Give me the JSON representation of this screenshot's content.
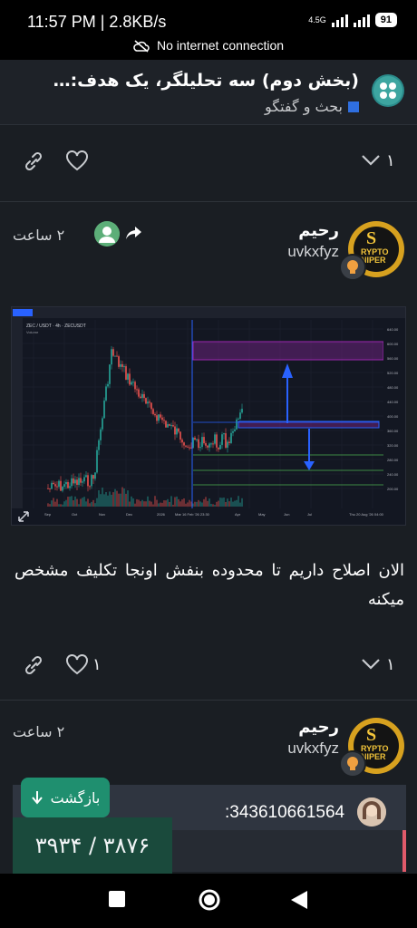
{
  "status_bar": {
    "time": "11:57 PM | 2.8KB/s",
    "network": "4.5G",
    "battery": "91",
    "offline_message": "No internet connection"
  },
  "topic": {
    "title": "(بخش دوم) سه تحلیلگر، یک هدف: سود گ...",
    "category": "بحث و گفتگو"
  },
  "prev_post_actions": {
    "like_count": "",
    "replies_count": "۱"
  },
  "post": {
    "author_name": "رحیم",
    "username": "uvkxfyz",
    "time": "۲ ساعت",
    "text": "الان اصلاح داریم تا محدوده بنفش اونجا تکلیف مشخص میکنه",
    "like_count": "۱",
    "replies_count": "۱"
  },
  "chart": {
    "symbol": "ZEC / USDT · 4h · ZECUSDT",
    "indicator": "Volume",
    "price_labels": [
      "640.00",
      "600.00",
      "560.00",
      "520.00",
      "480.00",
      "440.00",
      "400.00",
      "360.00",
      "320.00",
      "280.00",
      "240.00",
      "200.00"
    ],
    "time_labels": [
      "Sep",
      "Oct",
      "Nov",
      "Dec",
      "2026",
      "Mar 16 Feb '26  23:30",
      "Apr",
      "May",
      "Jun",
      "Jul",
      "Thu 20 Aug '26  04:00"
    ],
    "colors": {
      "zone": "#9c27b0",
      "arrow": "#2962ff",
      "green_line": "#4caf50"
    }
  },
  "next_post": {
    "author_name": "رحیم",
    "username": "uvkxfyz",
    "time": "۲ ساعت"
  },
  "reply_preview": {
    "number": ":343610661564"
  },
  "back_button": {
    "label": "بازگشت"
  },
  "progress": {
    "label": "۳۹۳۴ / ۳۸۷۶"
  },
  "avatar_text": {
    "line1": "RYPTO",
    "line2": "NIPER"
  }
}
